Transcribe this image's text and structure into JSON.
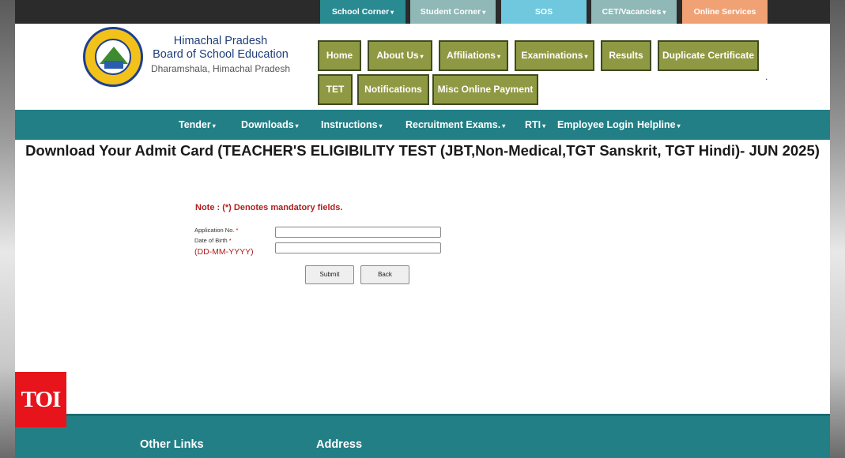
{
  "top_tabs": [
    {
      "label": "School Corner",
      "color": "#2a8a91",
      "dropdown": true
    },
    {
      "label": "Student Corner",
      "color": "#8fb8b6",
      "dropdown": true
    },
    {
      "label": "SOS",
      "color": "#6fc8de",
      "dropdown": false
    },
    {
      "label": "CET/Vacancies",
      "color": "#8fb8b6",
      "dropdown": true
    },
    {
      "label": "Online Services",
      "color": "#f0a274",
      "dropdown": false
    }
  ],
  "org": {
    "line1": "Himachal Pradesh",
    "line2": "Board of School Education",
    "line3": "Dharamshala, Himachal Pradesh"
  },
  "nav_buttons": [
    {
      "label": "Home",
      "dropdown": false
    },
    {
      "label": "About Us",
      "dropdown": true
    },
    {
      "label": "Affiliations",
      "dropdown": true
    },
    {
      "label": "Examinations",
      "dropdown": true
    },
    {
      "label": "Results",
      "dropdown": false
    },
    {
      "label": "Duplicate Certificate",
      "dropdown": false
    },
    {
      "label": "TET",
      "dropdown": false
    },
    {
      "label": "Notifications",
      "dropdown": false
    },
    {
      "label": "Misc Online Payment",
      "dropdown": false
    }
  ],
  "nav_separator": ".",
  "menu": [
    {
      "label": "Tender",
      "dropdown": true
    },
    {
      "label": "Downloads",
      "dropdown": true
    },
    {
      "label": "Instructions",
      "dropdown": true
    },
    {
      "label": "Recruitment Exams.",
      "dropdown": true
    },
    {
      "label": "RTI",
      "dropdown": true
    },
    {
      "label": "Employee Login",
      "dropdown": false
    },
    {
      "label": "Helpline",
      "dropdown": true
    }
  ],
  "page_title": "Download Your Admit Card (TEACHER'S ELIGIBILITY TEST (JBT,Non-Medical,TGT Sanskrit, TGT Hindi)- JUN 2025)",
  "form": {
    "note": "Note  : (*) Denotes mandatory fields.",
    "application_label": "Application No.",
    "dob_label": "Date of Birth",
    "required_mark": "*",
    "dob_format": "(DD-MM-YYYY)",
    "application_value": "",
    "dob_value": "",
    "submit_label": "Submit",
    "back_label": "Back"
  },
  "footer": {
    "other_links": "Other Links",
    "address": "Address"
  },
  "watermark": "TOI",
  "colors": {
    "teal": "#227f86",
    "olive_button": "#8f9943",
    "required_red": "#b02020",
    "toi_red": "#e8141c"
  }
}
